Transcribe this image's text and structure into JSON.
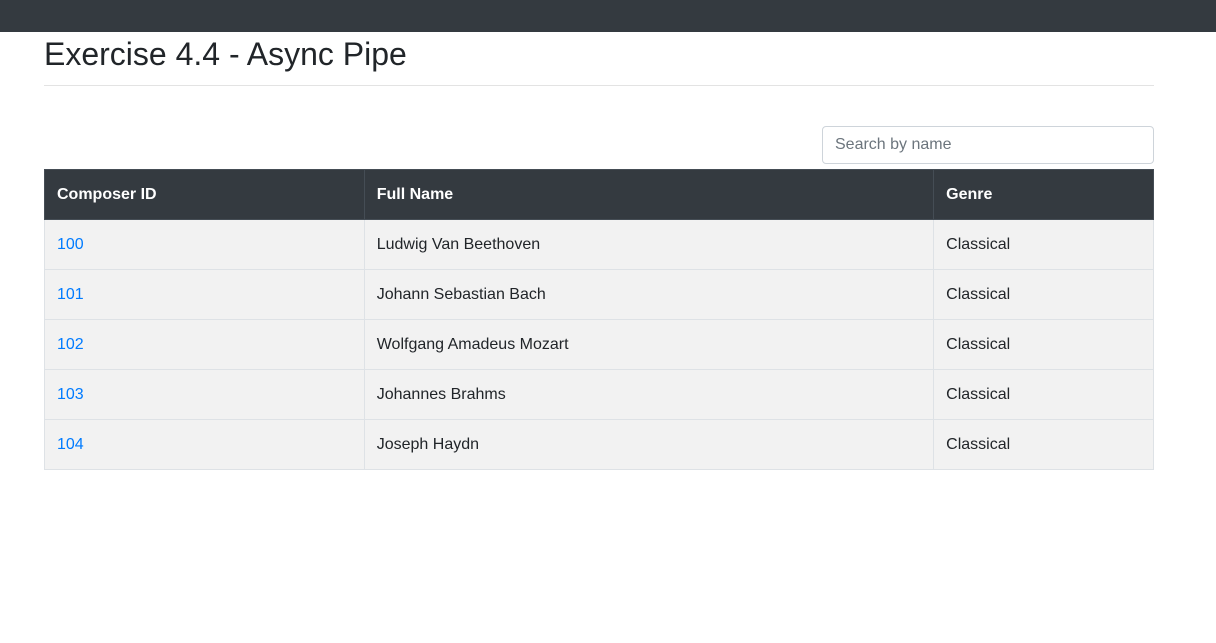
{
  "header": {
    "title": "Exercise 4.4 - Async Pipe"
  },
  "search": {
    "placeholder": "Search by name",
    "value": ""
  },
  "table": {
    "columns": [
      "Composer ID",
      "Full Name",
      "Genre"
    ],
    "rows": [
      {
        "id": "100",
        "name": "Ludwig Van Beethoven",
        "genre": "Classical"
      },
      {
        "id": "101",
        "name": "Johann Sebastian Bach",
        "genre": "Classical"
      },
      {
        "id": "102",
        "name": "Wolfgang Amadeus Mozart",
        "genre": "Classical"
      },
      {
        "id": "103",
        "name": "Johannes Brahms",
        "genre": "Classical"
      },
      {
        "id": "104",
        "name": "Joseph Haydn",
        "genre": "Classical"
      }
    ]
  },
  "colors": {
    "navbar": "#343a40",
    "link": "#007bff",
    "row_background": "#f2f2f2"
  }
}
